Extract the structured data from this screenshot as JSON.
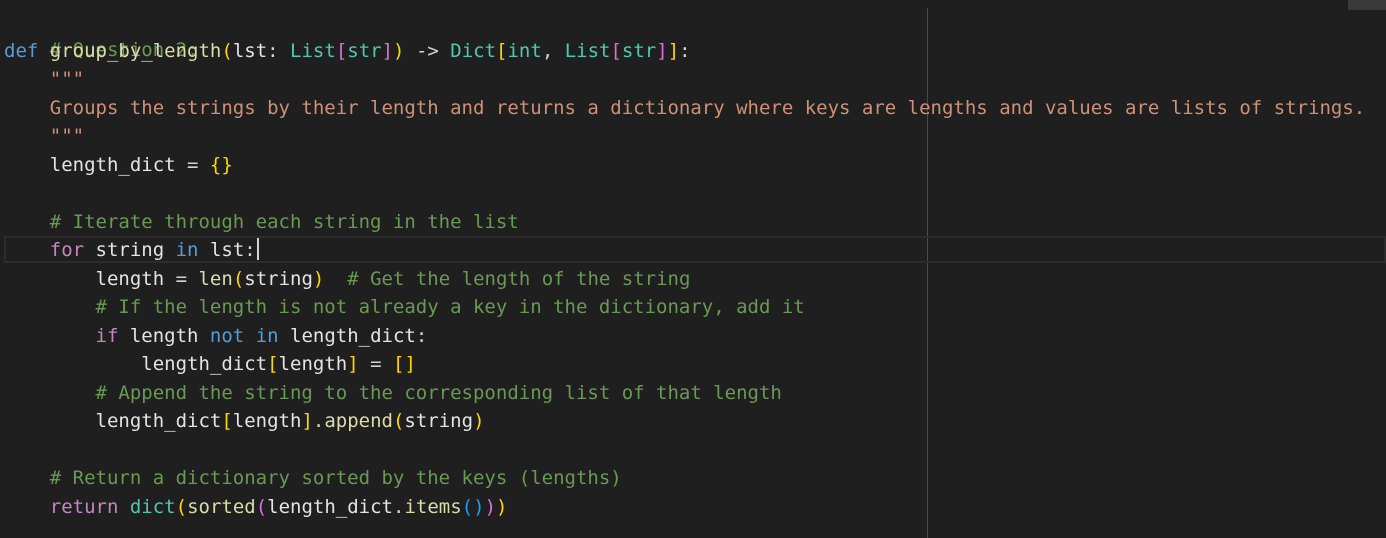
{
  "editor": {
    "line_01": {
      "comment": "# Question 2:"
    },
    "line_02": {
      "kw_def": "def",
      "func_name": "group_by_length",
      "paren_open": "(",
      "param": "lst",
      "colon1": ": ",
      "type_list": "List",
      "br_open1": "[",
      "type_str1": "str",
      "br_close1": "]",
      "paren_close": ")",
      "arrow": " -> ",
      "type_dict": "Dict",
      "br_open2": "[",
      "type_int": "int",
      "comma": ", ",
      "type_list2": "List",
      "br_open3": "[",
      "type_str2": "str",
      "br_close3": "]",
      "br_close2": "]",
      "colon2": ":"
    },
    "line_03": {
      "docstring_open": "    \"\"\""
    },
    "line_04": {
      "docstring_text": "    Groups the strings by their length and returns a dictionary where keys are lengths and values are lists of strings."
    },
    "line_05": {
      "docstring_close": "    \"\"\""
    },
    "line_06": {
      "var": "    length_dict",
      "op": " = ",
      "br_open": "{",
      "br_close": "}"
    },
    "line_08": {
      "comment": "    # Iterate through each string in the list"
    },
    "line_09": {
      "indent": "    ",
      "kw_for": "for",
      "var_string": " string ",
      "kw_in": "in",
      "var_lst": " lst",
      "colon": ":"
    },
    "line_10": {
      "var": "        length",
      "op": " = ",
      "fn_len": "len",
      "paren_open": "(",
      "arg": "string",
      "paren_close": ")",
      "comment": "  # Get the length of the string"
    },
    "line_11": {
      "comment": "        # If the length is not already a key in the dictionary, add it"
    },
    "line_12": {
      "indent": "        ",
      "kw_if": "if",
      "var_length": " length ",
      "kw_not": "not",
      "space": " ",
      "kw_in": "in",
      "var_dict": " length_dict",
      "colon": ":"
    },
    "line_13": {
      "var": "            length_dict",
      "br_open": "[",
      "key": "length",
      "br_close": "]",
      "op": " = ",
      "list_open": "[",
      "list_close": "]"
    },
    "line_14": {
      "comment": "        # Append the string to the corresponding list of that length"
    },
    "line_15": {
      "var": "        length_dict",
      "br_open": "[",
      "key": "length",
      "br_close": "]",
      "method": ".append",
      "paren_open": "(",
      "arg": "string",
      "paren_close": ")"
    },
    "line_17": {
      "comment": "    # Return a dictionary sorted by the keys (lengths)"
    },
    "line_18": {
      "indent": "    ",
      "kw_return": "return",
      "space": " ",
      "fn_dict": "dict",
      "p1_open": "(",
      "fn_sorted": "sorted",
      "p2_open": "(",
      "var": "length_dict",
      "method": ".items",
      "p3_open": "(",
      "p3_close": ")",
      "p2_close": ")",
      "p1_close": ")"
    }
  }
}
